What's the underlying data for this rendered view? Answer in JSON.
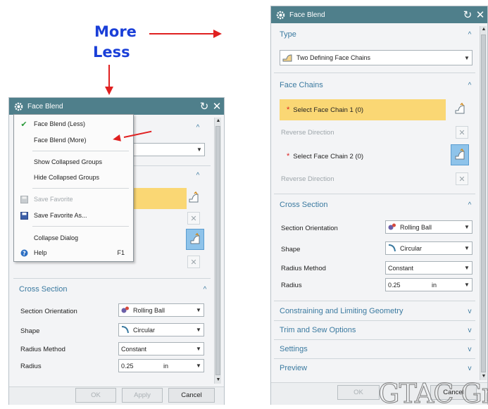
{
  "annotations": {
    "more": "More",
    "less": "Less"
  },
  "left_dialog": {
    "title": "Face Blend",
    "context_menu": {
      "items": [
        {
          "label": "Face Blend (Less)",
          "checked": true
        },
        {
          "label": "Face Blend (More)"
        },
        {
          "label": "Show Collapsed Groups"
        },
        {
          "label": "Hide Collapsed Groups"
        },
        {
          "label": "Save Favorite",
          "disabled": true
        },
        {
          "label": "Save Favorite As..."
        },
        {
          "label": "Collapse Dialog"
        },
        {
          "label": "Help",
          "shortcut": "F1"
        }
      ]
    },
    "cross_section": {
      "header": "Cross Section",
      "section_orientation_label": "Section Orientation",
      "section_orientation_value": "Rolling Ball",
      "shape_label": "Shape",
      "shape_value": "Circular",
      "radius_method_label": "Radius Method",
      "radius_method_value": "Constant",
      "radius_label": "Radius",
      "radius_value": "0.25",
      "radius_unit": "in"
    },
    "buttons": {
      "ok": "OK",
      "apply": "Apply",
      "cancel": "Cancel"
    }
  },
  "right_dialog": {
    "title": "Face Blend",
    "type": {
      "header": "Type",
      "value": "Two Defining Face Chains"
    },
    "face_chains": {
      "header": "Face Chains",
      "chain1": "Select Face Chain 1 (0)",
      "reverse1": "Reverse Direction",
      "chain2": "Select Face Chain 2 (0)",
      "reverse2": "Reverse Direction"
    },
    "cross_section": {
      "header": "Cross Section",
      "section_orientation_label": "Section Orientation",
      "section_orientation_value": "Rolling Ball",
      "shape_label": "Shape",
      "shape_value": "Circular",
      "radius_method_label": "Radius Method",
      "radius_method_value": "Constant",
      "radius_label": "Radius",
      "radius_value": "0.25",
      "radius_unit": "in"
    },
    "collapsed_groups": [
      "Constraining and Limiting Geometry",
      "Trim and Sew Options",
      "Settings",
      "Preview"
    ],
    "buttons": {
      "ok": "OK",
      "cancel": "Cancel"
    }
  },
  "watermark": "GTAC Gr",
  "colors": {
    "titlebar": "#4f7f8b",
    "section_header": "#3b7aa0",
    "selection_highlight": "#fad774",
    "annotation_text": "#1a3fd8",
    "annotation_arrow": "#e02020"
  }
}
